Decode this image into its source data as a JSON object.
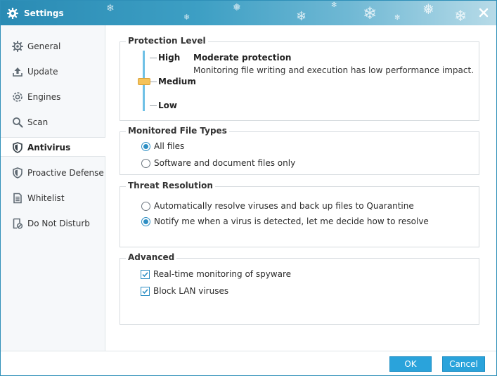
{
  "window": {
    "title": "Settings"
  },
  "sidebar": {
    "items": [
      {
        "label": "General",
        "icon": "gear-icon"
      },
      {
        "label": "Update",
        "icon": "upload-icon"
      },
      {
        "label": "Engines",
        "icon": "engine-icon"
      },
      {
        "label": "Scan",
        "icon": "search-icon"
      },
      {
        "label": "Antivirus",
        "icon": "shield-icon",
        "active": true
      },
      {
        "label": "Proactive Defense",
        "icon": "shield-icon"
      },
      {
        "label": "Whitelist",
        "icon": "list-icon"
      },
      {
        "label": "Do Not Disturb",
        "icon": "do-not-disturb-icon"
      }
    ]
  },
  "protection_level": {
    "legend": "Protection Level",
    "levels": [
      "High",
      "Medium",
      "Low"
    ],
    "selected": "Medium",
    "title": "Moderate protection",
    "description": "Monitoring file writing and execution has low performance impact."
  },
  "monitored_file_types": {
    "legend": "Monitored File Types",
    "options": [
      {
        "label": "All files",
        "selected": true
      },
      {
        "label": "Software and document files only",
        "selected": false
      }
    ]
  },
  "threat_resolution": {
    "legend": "Threat Resolution",
    "options": [
      {
        "label": "Automatically resolve viruses and back up files to Quarantine",
        "selected": false
      },
      {
        "label": "Notify me when a virus is detected, let me decide how to resolve",
        "selected": true
      }
    ]
  },
  "advanced": {
    "legend": "Advanced",
    "options": [
      {
        "label": "Real-time monitoring of spyware",
        "checked": true
      },
      {
        "label": "Block LAN viruses",
        "checked": true
      }
    ]
  },
  "footer": {
    "ok_label": "OK",
    "cancel_label": "Cancel"
  },
  "colors": {
    "accent": "#2aa3db",
    "titlebar": "#2a8bb4",
    "slider": "#6ec0e6",
    "thumb": "#f4c25a"
  }
}
